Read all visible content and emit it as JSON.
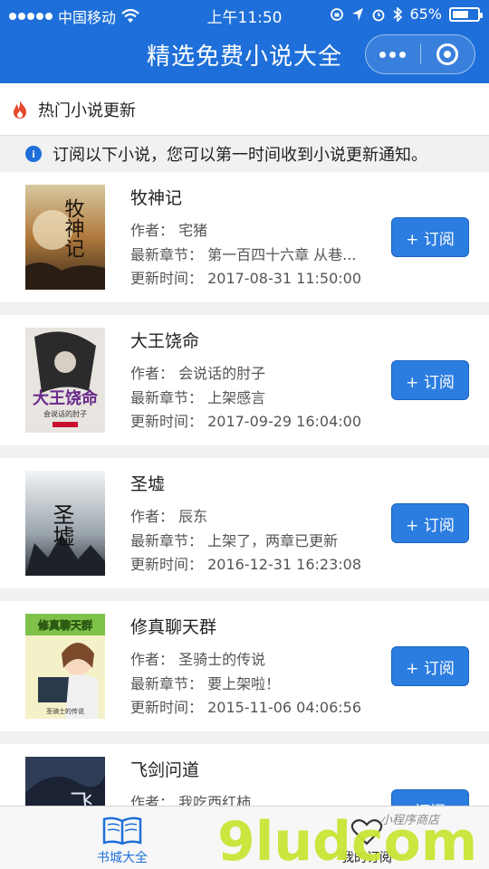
{
  "status_bar": {
    "carrier": "中国移动",
    "time": "上午11:50",
    "battery": "65%",
    "battery_level": 0.65
  },
  "nav": {
    "title": "精选免费小说大全"
  },
  "section": {
    "title": "热门小说更新",
    "notice": "订阅以下小说，您可以第一时间收到小说更新通知。"
  },
  "books": [
    {
      "name": "牧神记",
      "author": "作者：  宅猪",
      "latest": "最新章节：  第一百四十六章 从巷...",
      "updated": "更新时间：  2017-08-31 11:50:00",
      "button": "+ 订阅"
    },
    {
      "name": "大王饶命",
      "author": "作者：  会说话的肘子",
      "latest": "最新章节：  上架感言",
      "updated": "更新时间：  2017-09-29 16:04:00",
      "button": "+ 订阅"
    },
    {
      "name": "圣墟",
      "author": "作者：  辰东",
      "latest": "最新章节：  上架了，两章已更新",
      "updated": "更新时间：  2016-12-31 16:23:08",
      "button": "+ 订阅"
    },
    {
      "name": "修真聊天群",
      "author": "作者：  圣骑士的传说",
      "latest": "最新章节：  要上架啦！",
      "updated": "更新时间：  2015-11-06 04:06:56",
      "button": "+ 订阅"
    },
    {
      "name": "飞剑问道",
      "author": "作者：  我吃西红柿",
      "latest": "",
      "updated": "",
      "button": "订阅"
    }
  ],
  "cover_text": {
    "c1": "牧神记",
    "c2": "大王饶命",
    "c2_sub": "会说话的肘子",
    "c3": "圣墟",
    "c4": "修真聊天群",
    "c4_sub": "圣骑士的传说",
    "c5": "飞"
  },
  "tabbar": {
    "tab1": "书城大全",
    "tab2": "我的订阅"
  },
  "watermark": {
    "brand": "9ludcom",
    "sub": "小程序商店"
  },
  "colors": {
    "primary": "#1e6fd9",
    "button": "#2b7de0",
    "background": "#f1f1f1"
  }
}
